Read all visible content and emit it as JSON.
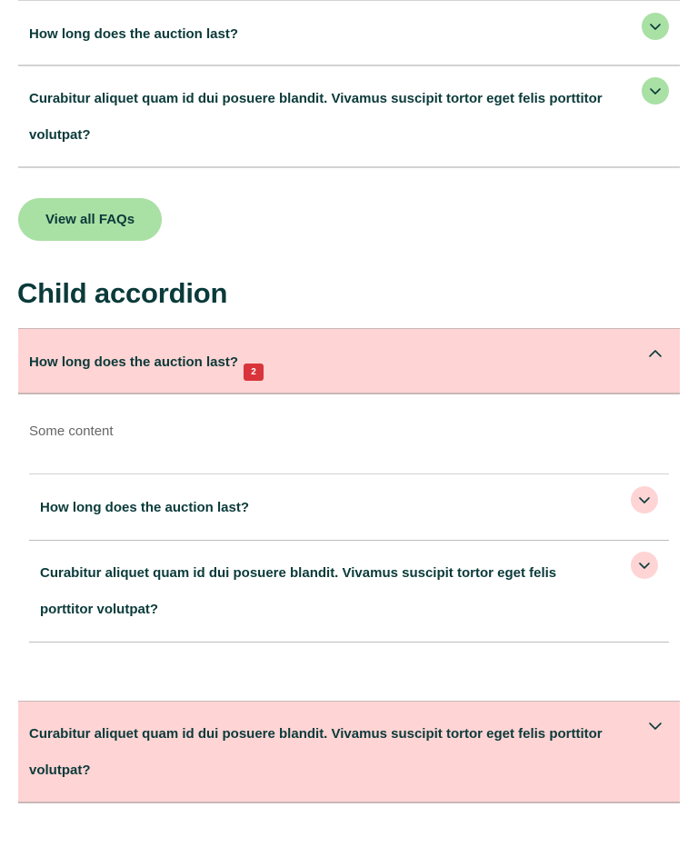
{
  "faq": {
    "items": [
      {
        "question": "How long does the auction last?"
      },
      {
        "question": "Curabitur aliquet quam id dui posuere blandit. Vivamus suscipit tortor eget felis porttitor volutpat?"
      }
    ],
    "button_label": "View all FAQs"
  },
  "child_section": {
    "title": "Child accordion",
    "parent": {
      "question": "How long does the auction last?",
      "badge": "2",
      "content": "Some content"
    },
    "nested_items": [
      {
        "question": "How long does the auction last?"
      },
      {
        "question": "Curabitur aliquet quam id dui posuere blandit. Vivamus suscipit tortor eget felis porttitor volutpat?"
      }
    ],
    "bottom_item": {
      "question": "Curabitur aliquet quam id dui posuere blandit. Vivamus suscipit tortor eget felis porttitor volutpat?"
    }
  },
  "colors": {
    "text": "#0b3a3a",
    "green_accent": "#a9e0a4",
    "pink_accent": "#ffd4d4",
    "badge": "#d9343b"
  },
  "icons": {
    "collapsed": "chevron-down-icon",
    "expanded": "chevron-up-icon"
  }
}
